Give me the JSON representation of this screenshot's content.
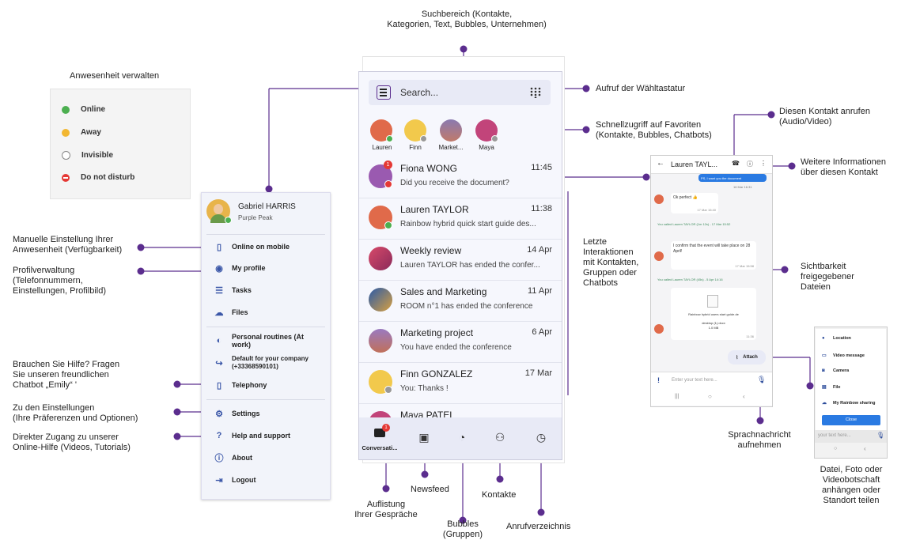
{
  "annotations": {
    "search_area": "Suchbereich (Kontakte,\nKategorien, Text, Bubbles, Unternehmen)",
    "dialpad": "Aufruf der Wähltastatur",
    "favorites": "Schnellzugriff auf Favoriten\n(Kontakte, Bubbles, Chatbots)",
    "call_contact": "Diesen Kontakt anrufen\n(Audio/Video)",
    "more_info": "Weitere Informationen\nüber diesen Kontakt",
    "recent": "Letzte\nInteraktionen\nmit Kontakten,\nGruppen oder\nChatbots",
    "files_visibility": "Sichtbarkeit\nfreigegebener\nDateien",
    "presence_title": "Anwesenheit verwalten",
    "manual_presence": "Manuelle Einstellung Ihrer\nAnwesenheit (Verfügbarkeit)",
    "profile_mgmt": "Profilverwaltung\n(Telefonnummern,\n Einstellungen, Profilbild)",
    "help_chatbot": "Brauchen Sie Hilfe? Fragen\nSie unseren freundlichen\nChatbot „Emily“ '",
    "settings": "Zu den Einstellungen\n(Ihre Präferenzen und Optionen)",
    "online_help": "Direkter Zugang zu unserer\nOnline-Hilfe (Videos, Tutorials)",
    "list_conversations": "Auflistung\nIhrer Gespräche",
    "newsfeed": "Newsfeed",
    "bubbles": "Bubbles\n(Gruppen)",
    "contacts": "Kontakte",
    "call_log": "Anrufverzeichnis",
    "voice_message": "Sprachnachricht\naufnehmen",
    "attach_share": "Datei, Foto oder\nVideobotschaft\nanhängen oder\nStandort teilen"
  },
  "presence": {
    "items": [
      {
        "label": "Online",
        "color": "#4caf50"
      },
      {
        "label": "Away",
        "color": "#f2b731"
      },
      {
        "label": "Invisible",
        "color": "#ffffff"
      },
      {
        "label": "Do not disturb",
        "color": "#e53935"
      }
    ]
  },
  "menu": {
    "user_name": "Gabriel HARRIS",
    "company": "Purple Peak",
    "items": [
      {
        "label": "Online on mobile",
        "icon": "phone-icon"
      },
      {
        "label": "My profile",
        "icon": "profile-icon"
      },
      {
        "label": "Tasks",
        "icon": "tasks-icon"
      },
      {
        "label": "Files",
        "icon": "cloud-icon"
      },
      {
        "label": "Personal routines (At work)",
        "icon": "routine-icon"
      },
      {
        "label": "Default for your company (+33368590101)",
        "icon": "forward-call-icon"
      },
      {
        "label": "Telephony",
        "icon": "phone-icon"
      },
      {
        "label": "Settings",
        "icon": "gear-icon"
      },
      {
        "label": "Help and support",
        "icon": "help-icon"
      },
      {
        "label": "About",
        "icon": "info-icon"
      },
      {
        "label": "Logout",
        "icon": "logout-icon"
      }
    ]
  },
  "main": {
    "search_placeholder": "Search...",
    "favorites": [
      "Lauren",
      "Finn",
      "Market...",
      "Maya"
    ],
    "conversations": [
      {
        "name": "Fiona WONG",
        "time": "11:45",
        "preview": "Did you receive the document?",
        "badge": "1"
      },
      {
        "name": "Lauren TAYLOR",
        "time": "11:38",
        "preview": "Rainbow hybrid quick start guide des..."
      },
      {
        "name": "Weekly review",
        "time": "14 Apr",
        "preview": "Lauren TAYLOR has ended the confer..."
      },
      {
        "name": "Sales and Marketing",
        "time": "11 Apr",
        "preview": "ROOM n°1 has ended the conference"
      },
      {
        "name": "Marketing project",
        "time": "6 Apr",
        "preview": "You have ended the conference"
      },
      {
        "name": "Finn GONZALEZ",
        "time": "17 Mar",
        "preview": "You: Thanks !"
      },
      {
        "name": "Maya PATEL",
        "time": "",
        "preview": ""
      }
    ],
    "nav": {
      "conversations_label": "Conversati...",
      "badge": "1"
    }
  },
  "chat": {
    "contact": "Lauren TAYL...",
    "top_snippet": "PS, I want you the document",
    "top_time": "16 Mar 16:31",
    "msg1": "Ok perfect 👍",
    "msg1_time": "17 Mar 15:40",
    "sys1": "You called Lauren TAYLOR (1m 12s) - 17 Mar 15:52",
    "msg2": "I confirm that the event will take place on 28 April!",
    "msg2_time": "17 Mar 15:58",
    "sys2": "You called Lauren TAYLOR (45s) - 5 Apr 14:16",
    "file_name": "Rainbow hybrid users start guide.de",
    "file_meta1": "desktop (1).docx",
    "file_meta2": "1.0 MB",
    "file_time": "11:36",
    "attach_label": "Attach",
    "input_placeholder": "Enter your text here..."
  },
  "attach_menu": {
    "items": [
      "Location",
      "Video message",
      "Camera",
      "File",
      "My Rainbow sharing"
    ],
    "close": "Close",
    "input_placeholder": "your text here..."
  }
}
